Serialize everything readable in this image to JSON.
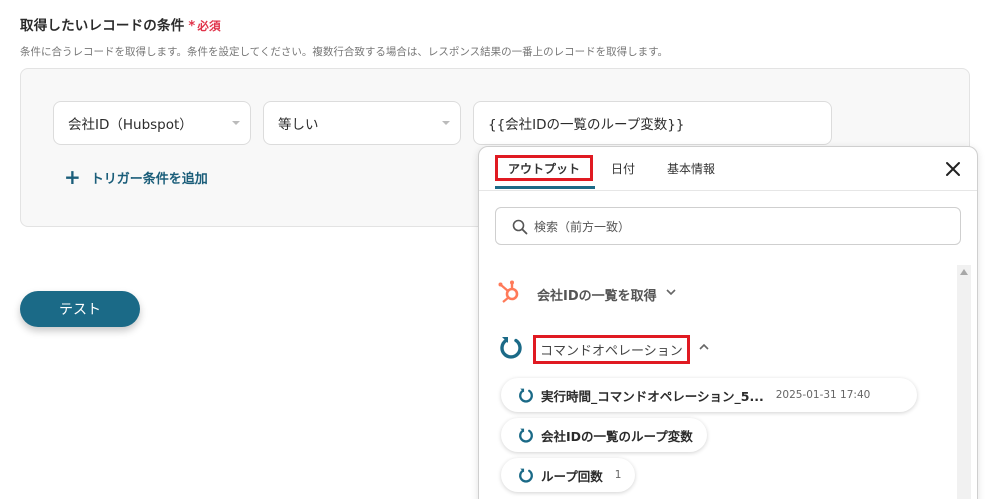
{
  "section": {
    "title": "取得したいレコードの条件",
    "required_star": "*",
    "required_text": "必須",
    "description": "条件に合うレコードを取得します。条件を設定してください。複数行合致する場合は、レスポンス結果の一番上のレコードを取得します。"
  },
  "condition": {
    "field_value": "会社ID（Hubspot）",
    "operator_value": "等しい",
    "value_text": "{{会社IDの一覧のループ変数}}",
    "add_label": "トリガー条件を追加"
  },
  "test_button": "テスト",
  "panel": {
    "tabs": [
      "アウトプット",
      "日付",
      "基本情報"
    ],
    "search_placeholder": "検索（前方一致）",
    "groups": [
      {
        "label": "会社IDの一覧を取得",
        "icon": "hubspot-icon"
      },
      {
        "label": "コマンドオペレーション",
        "icon": "loop-icon"
      }
    ],
    "items": [
      {
        "label": "実行時間_コマンドオペレーション_5...",
        "meta": "2025-01-31 17:40"
      },
      {
        "label": "会社IDの一覧のループ変数",
        "meta": ""
      },
      {
        "label": "ループ回数",
        "meta": "1"
      }
    ]
  },
  "colors": {
    "accent": "#1b6a87",
    "required": "#e0334a",
    "highlight": "#e01a22",
    "hubspot": "#ff7a59"
  }
}
